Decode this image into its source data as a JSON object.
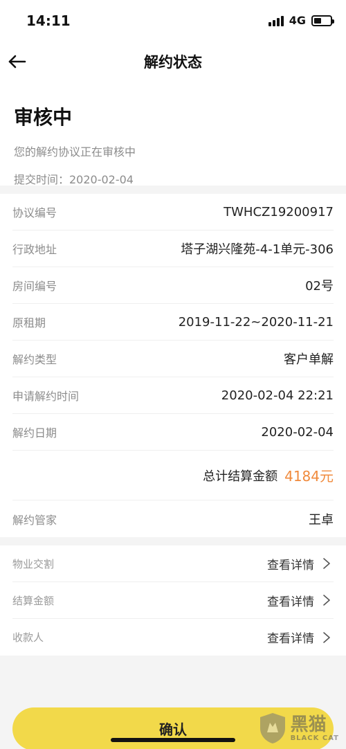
{
  "status_bar": {
    "time": "14:11",
    "network": "4G",
    "battery_level": 0.45
  },
  "nav": {
    "title": "解约状态",
    "back_icon": "back-arrow-icon"
  },
  "status": {
    "heading": "审核中",
    "description": "您的解约协议正在审核中",
    "submit_time": "提交时间：2020-02-04"
  },
  "info": {
    "rows": [
      {
        "label": "协议编号",
        "value": "TWHCZ19200917"
      },
      {
        "label": "行政地址",
        "value": "塔子湖兴隆苑-4-1单元-306"
      },
      {
        "label": "房间编号",
        "value": "02号"
      },
      {
        "label": "原租期",
        "value": "2019-11-22~2020-11-21"
      },
      {
        "label": "解约类型",
        "value": "客户单解"
      },
      {
        "label": "申请解约时间",
        "value": "2020-02-04 22:21"
      },
      {
        "label": "解约日期",
        "value": "2020-02-04"
      }
    ],
    "total_label": "总计结算金额",
    "total_value": "4184元",
    "manager_label": "解约管家",
    "manager_value": "王卓"
  },
  "details": {
    "rows": [
      {
        "label": "物业交割",
        "link": "查看详情"
      },
      {
        "label": "结算金额",
        "link": "查看详情"
      },
      {
        "label": "收款人",
        "link": "查看详情"
      }
    ]
  },
  "confirm_label": "确认",
  "watermark": {
    "cn": "黑猫",
    "en": "BLACK CAT"
  },
  "colors": {
    "accent": "#f2d94a",
    "amount": "#f08a3c"
  }
}
